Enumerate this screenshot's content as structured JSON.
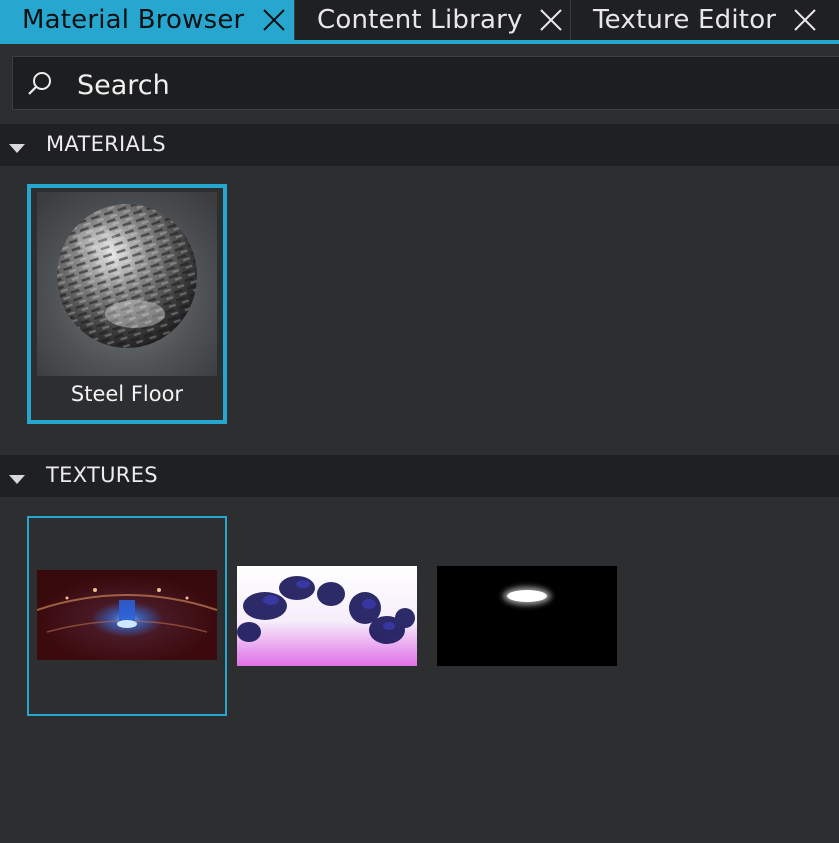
{
  "tabs": [
    {
      "label": "Material Browser",
      "active": true
    },
    {
      "label": "Content Library",
      "active": false
    },
    {
      "label": "Texture Editor",
      "active": false
    }
  ],
  "search": {
    "placeholder": "Search",
    "value": ""
  },
  "sections": {
    "materials": {
      "title": "MATERIALS",
      "items": [
        {
          "label": "Steel Floor",
          "selected": true,
          "thumbnail": "metallic-sphere-preview"
        }
      ]
    },
    "textures": {
      "title": "TEXTURES",
      "items": [
        {
          "thumbnail": "dark-red-hdri-panorama",
          "selected": true
        },
        {
          "thumbnail": "purple-white-hdri-panorama",
          "selected": false
        },
        {
          "thumbnail": "black-light-spot-texture",
          "selected": false
        }
      ]
    }
  },
  "colors": {
    "accent": "#27a7cf",
    "background": "#2d2e30",
    "header_background": "#1f2023",
    "text": "#ececec"
  }
}
